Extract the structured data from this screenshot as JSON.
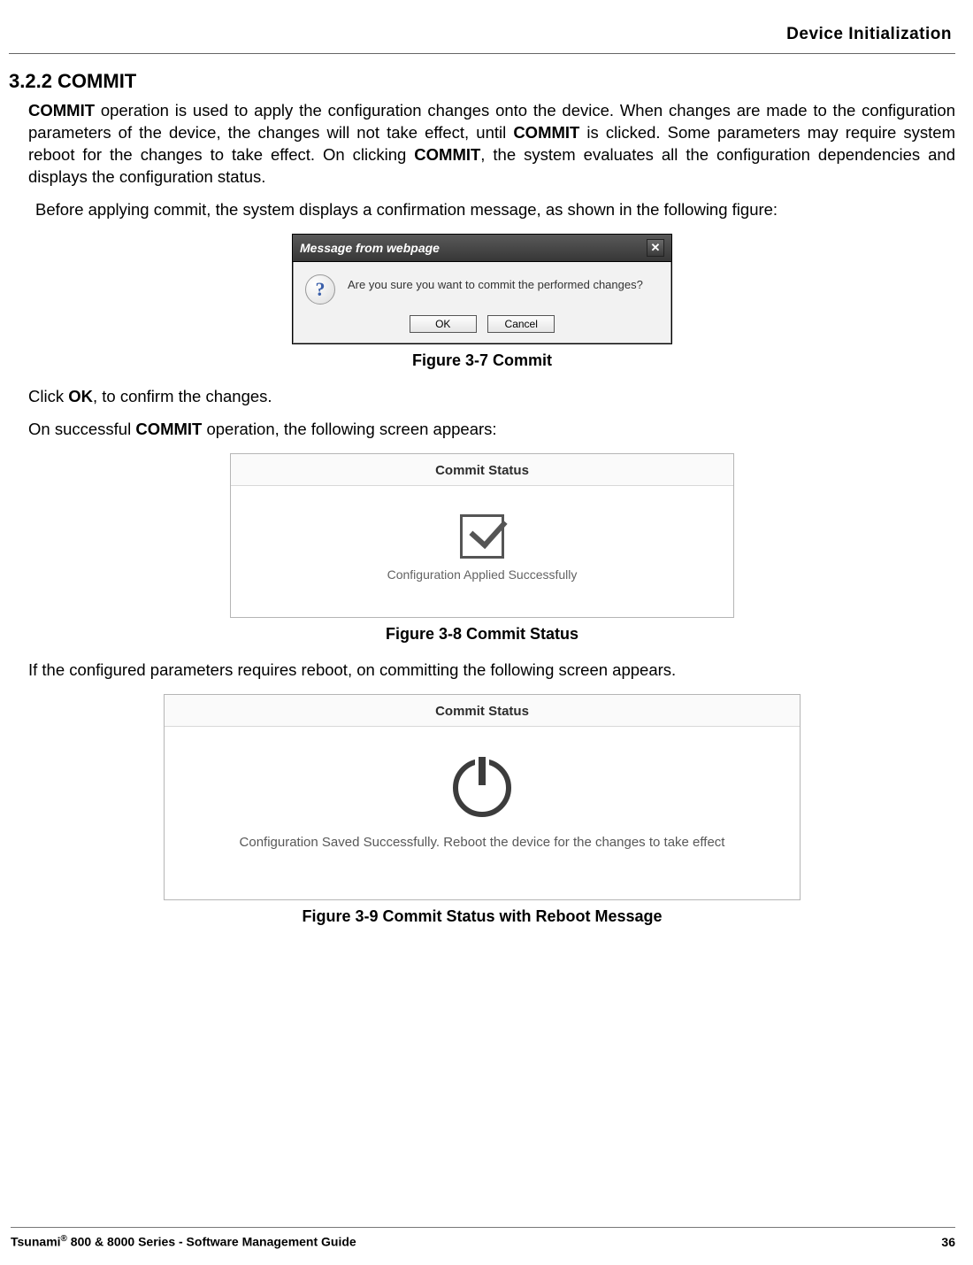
{
  "header": {
    "title": "Device Initialization"
  },
  "section": {
    "number_title": "3.2.2 COMMIT",
    "p1_prefix_bold": "COMMIT",
    "p1_mid": " operation is used to apply the configuration changes onto the device. When changes are made to the configuration parameters of the device, the changes will not take effect, until ",
    "p1_bold2": "COMMIT",
    "p1_mid2": " is clicked. Some parameters may require system reboot for the changes to take effect. On clicking ",
    "p1_bold3": "COMMIT",
    "p1_tail": ", the system evaluates all the configuration dependencies and displays the configuration status.",
    "p2": "Before applying commit, the system displays a confirmation message, as shown in the following figure:"
  },
  "dialog1": {
    "title": "Message from webpage",
    "question_glyph": "?",
    "close_glyph": "✕",
    "message": "Are you sure you want to commit the performed changes?",
    "ok": "OK",
    "cancel": "Cancel"
  },
  "captions": {
    "fig1": "Figure 3-7 Commit",
    "fig2": "Figure 3-8 Commit Status",
    "fig3": "Figure 3-9 Commit Status with Reboot Message"
  },
  "post_dialog": {
    "line1_pre": "Click ",
    "line1_bold": "OK",
    "line1_post": ", to confirm the changes.",
    "line2_pre": "On successful ",
    "line2_bold": "COMMIT",
    "line2_post": " operation, the following screen appears:"
  },
  "panel1": {
    "title": "Commit Status",
    "message": "Configuration Applied Successfully"
  },
  "between": {
    "text": "If the configured parameters requires reboot, on committing the following screen appears."
  },
  "panel2": {
    "title": "Commit Status",
    "message": "Configuration Saved Successfully. Reboot the device for the changes to take effect"
  },
  "footer": {
    "left_pre": "Tsunami",
    "left_reg": "®",
    "left_post": " 800 & 8000 Series - Software Management Guide",
    "page": "36"
  }
}
